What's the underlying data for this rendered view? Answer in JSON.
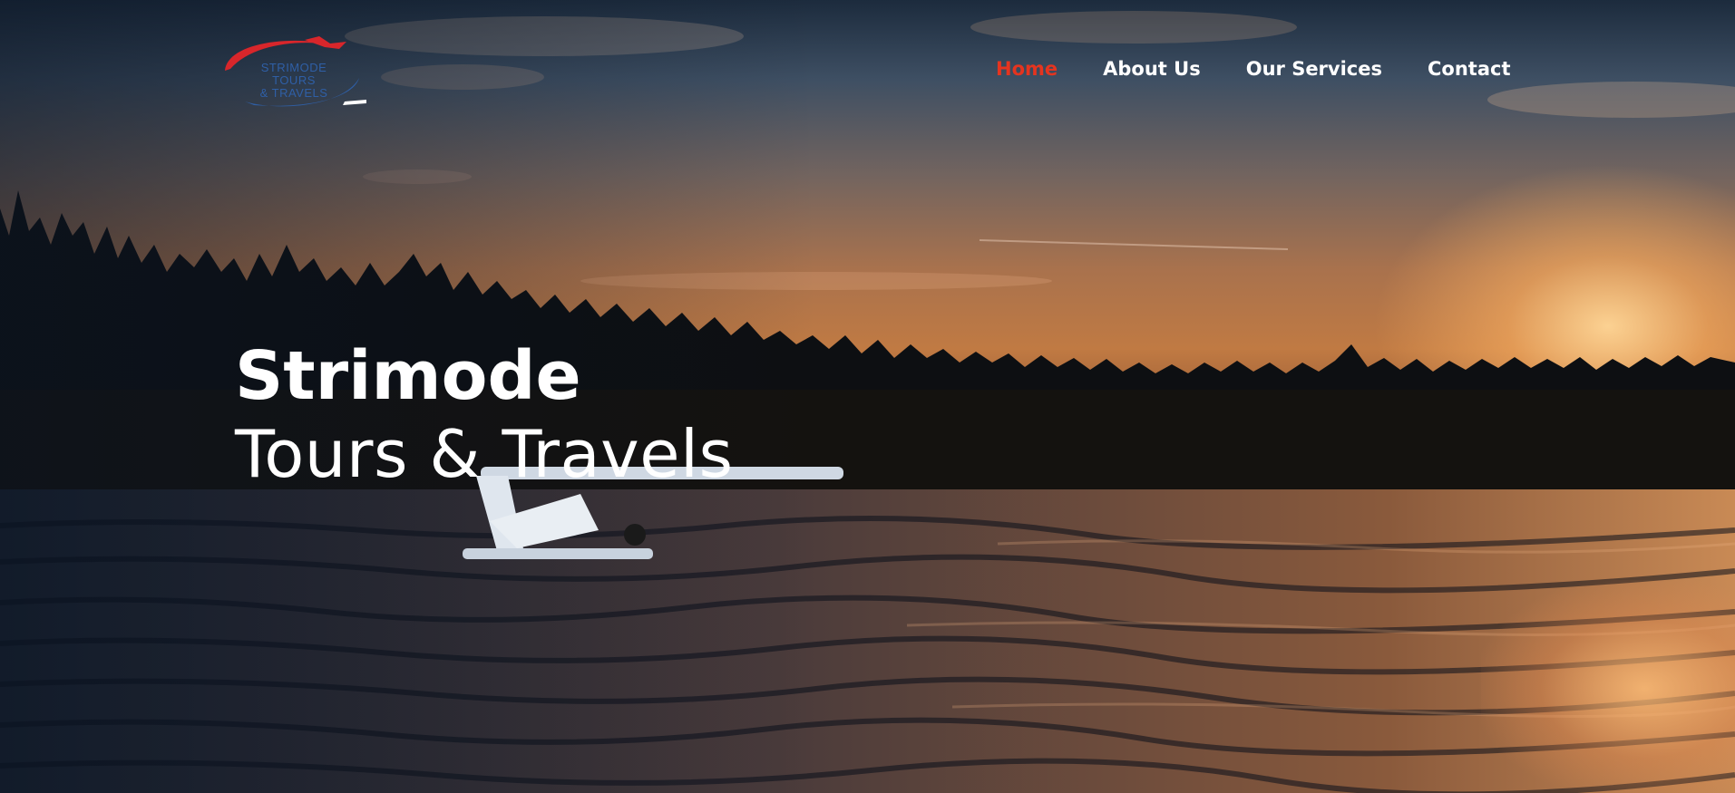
{
  "brand": {
    "logo_text_line1": "STRIMODE TOURS",
    "logo_text_line2": "& TRAVELS",
    "colors": {
      "red": "#e5341f",
      "blue": "#2f5fa6"
    }
  },
  "nav": {
    "items": [
      {
        "label": "Home",
        "active": true
      },
      {
        "label": "About Us",
        "active": false
      },
      {
        "label": "Our Services",
        "active": false
      },
      {
        "label": "Contact",
        "active": false
      }
    ]
  },
  "hero": {
    "title": "Strimode",
    "subtitle": "Tours & Travels",
    "background_description": "sunset-over-tidal-flat-with-floatplane-and-forest"
  }
}
